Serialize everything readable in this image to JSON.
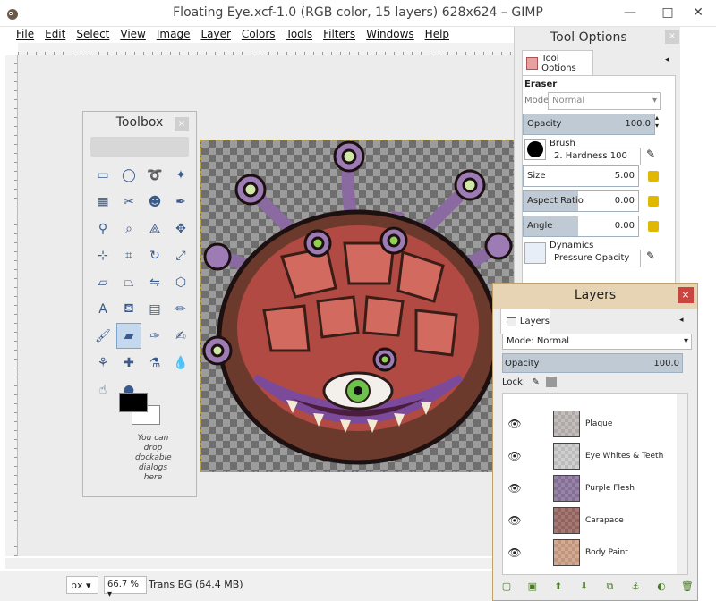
{
  "window": {
    "title": "Floating Eye.xcf-1.0 (RGB color, 15 layers) 628x624 – GIMP",
    "minimize": "—",
    "maximize": "□",
    "close": "✕"
  },
  "menu": {
    "items": [
      "File",
      "Edit",
      "Select",
      "View",
      "Image",
      "Layer",
      "Colors",
      "Tools",
      "Filters",
      "Windows",
      "Help"
    ]
  },
  "status": {
    "unit": "px",
    "zoom": "66.7 %",
    "text": "Trans BG (64.4 MB)"
  },
  "toolbox": {
    "title": "Toolbox",
    "close": "×",
    "drop_hint": "You can drop dockable dialogs here",
    "tools": [
      {
        "name": "rect-select-tool-icon",
        "glyph": "▭"
      },
      {
        "name": "ellipse-select-tool-icon",
        "glyph": "◯"
      },
      {
        "name": "free-select-tool-icon",
        "glyph": "➰"
      },
      {
        "name": "fuzzy-select-tool-icon",
        "glyph": "✦"
      },
      {
        "name": "select-by-color-tool-icon",
        "glyph": "▦"
      },
      {
        "name": "scissors-tool-icon",
        "glyph": "✂"
      },
      {
        "name": "foreground-select-tool-icon",
        "glyph": "☻"
      },
      {
        "name": "paths-tool-icon",
        "glyph": "✒"
      },
      {
        "name": "color-picker-tool-icon",
        "glyph": "⚲"
      },
      {
        "name": "zoom-tool-icon",
        "glyph": "⌕"
      },
      {
        "name": "measure-tool-icon",
        "glyph": "⟁"
      },
      {
        "name": "move-tool-icon",
        "glyph": "✥"
      },
      {
        "name": "align-tool-icon",
        "glyph": "⊹"
      },
      {
        "name": "crop-tool-icon",
        "glyph": "⌗"
      },
      {
        "name": "rotate-tool-icon",
        "glyph": "↻"
      },
      {
        "name": "scale-tool-icon",
        "glyph": "⤢"
      },
      {
        "name": "shear-tool-icon",
        "glyph": "▱"
      },
      {
        "name": "perspective-tool-icon",
        "glyph": "⏢"
      },
      {
        "name": "flip-tool-icon",
        "glyph": "⇋"
      },
      {
        "name": "cage-transform-tool-icon",
        "glyph": "⬡"
      },
      {
        "name": "text-tool-icon",
        "glyph": "A"
      },
      {
        "name": "bucket-fill-tool-icon",
        "glyph": "⛾"
      },
      {
        "name": "blend-tool-icon",
        "glyph": "▤"
      },
      {
        "name": "pencil-tool-icon",
        "glyph": "✏"
      },
      {
        "name": "paintbrush-tool-icon",
        "glyph": "🖌"
      },
      {
        "name": "eraser-tool-icon",
        "glyph": "▰"
      },
      {
        "name": "airbrush-tool-icon",
        "glyph": "✑"
      },
      {
        "name": "ink-tool-icon",
        "glyph": "✍"
      },
      {
        "name": "clone-tool-icon",
        "glyph": "⚘"
      },
      {
        "name": "heal-tool-icon",
        "glyph": "✚"
      },
      {
        "name": "perspective-clone-tool-icon",
        "glyph": "⚗"
      },
      {
        "name": "blur-tool-icon",
        "glyph": "💧"
      },
      {
        "name": "smudge-tool-icon",
        "glyph": "☝"
      },
      {
        "name": "dodge-burn-tool-icon",
        "glyph": "●"
      }
    ],
    "active_tool_index": 25
  },
  "tool_options": {
    "window_title": "Tool Options",
    "close": "×",
    "tab_label": "Tool Options",
    "tool_name": "Eraser",
    "mode_label": "Mode:",
    "mode_value": "Normal",
    "opacity_label": "Opacity",
    "opacity_value": "100.0",
    "opacity_fraction": 1.0,
    "brush_label": "Brush",
    "brush_value": "2. Hardness 100",
    "size_label": "Size",
    "size_value": "5.00",
    "aspect_label": "Aspect Ratio",
    "aspect_value": "0.00",
    "angle_label": "Angle",
    "angle_value": "0.00",
    "dynamics_label": "Dynamics",
    "dynamics_value": "Pressure Opacity"
  },
  "layers": {
    "title": "Layers",
    "close": "×",
    "tab_label": "Layers",
    "mode_label": "Mode:",
    "mode_value": "Normal",
    "opacity_label": "Opacity",
    "opacity_value": "100.0",
    "lock_label": "Lock:",
    "rows": [
      {
        "name": "Plaque",
        "thumb": "#d4c9c8"
      },
      {
        "name": "Eye Whites & Teeth",
        "thumb": "#e9e9e9"
      },
      {
        "name": "Purple Flesh",
        "thumb": "#8b6aa7"
      },
      {
        "name": "Carapace",
        "thumb": "#a2574f"
      },
      {
        "name": "Body Paint",
        "thumb": "#f0ab82"
      }
    ],
    "footer_icons": [
      "new-layer-icon",
      "new-group-icon",
      "raise-layer-icon",
      "lower-layer-icon",
      "duplicate-layer-icon",
      "anchor-layer-icon",
      "mask-layer-icon",
      "delete-layer-icon"
    ]
  },
  "colors": {
    "layers_header": "#e6d4b4",
    "layers_border": "#c1a16a",
    "close_red": "#c9453f",
    "active_tool": "#c5d9ee",
    "slider_fill": "#bfcad4"
  }
}
